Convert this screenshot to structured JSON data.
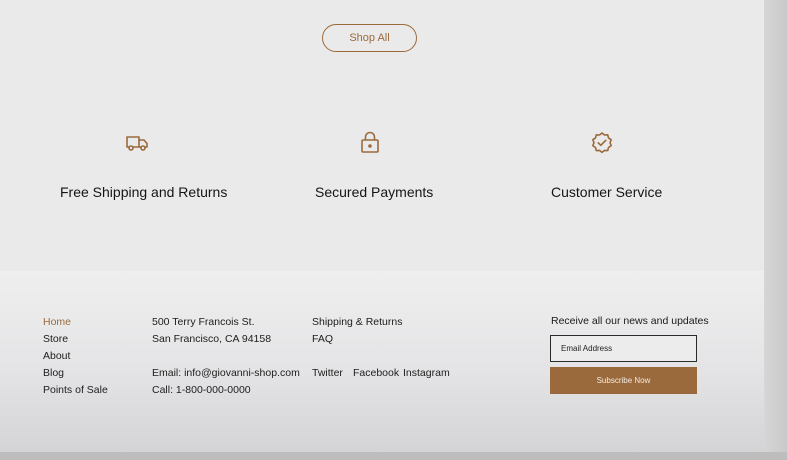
{
  "hero": {
    "shop_all_label": "Shop All"
  },
  "features": [
    {
      "icon": "truck-icon",
      "label": "Free Shipping and Returns"
    },
    {
      "icon": "lock-icon",
      "label": "Secured Payments"
    },
    {
      "icon": "badge-check-icon",
      "label": "Customer Service"
    }
  ],
  "footer": {
    "nav": [
      "Home",
      "Store",
      "About",
      "Blog",
      "Points of Sale"
    ],
    "address": {
      "street": "500 Terry Francois St.",
      "city": "San Francisco, CA 94158",
      "email": "Email: info@giovanni-shop.com",
      "phone": "Call: 1-800-000-0000"
    },
    "help_links": [
      "Shipping & Returns",
      "FAQ"
    ],
    "social": [
      "Twitter",
      "Facebook",
      "Instagram"
    ],
    "newsletter": {
      "title": "Receive all our news and updates",
      "email_placeholder": "Email Address",
      "subscribe_label": "Subscribe Now"
    }
  },
  "colors": {
    "accent": "#9b6a3c",
    "page_bg": "#ebeaea"
  }
}
